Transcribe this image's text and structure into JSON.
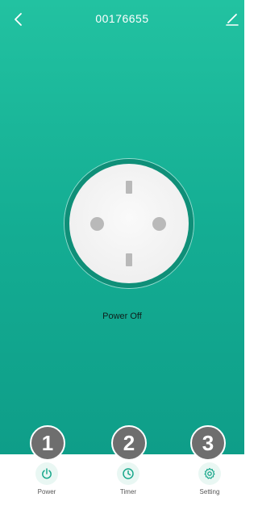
{
  "header": {
    "title": "00176655",
    "back_icon": "chevron-left-icon",
    "edit_icon": "pencil-icon"
  },
  "socket": {
    "status_text": "Power Off"
  },
  "bottom_nav": {
    "items": [
      {
        "label": "Power",
        "icon": "power-icon",
        "badge": "1"
      },
      {
        "label": "Timer",
        "icon": "clock-icon",
        "badge": "2"
      },
      {
        "label": "Setting",
        "icon": "gear-icon",
        "badge": "3"
      }
    ]
  },
  "colors": {
    "background_top": "#22c2a1",
    "background_bottom": "#0d9a86",
    "accent": "#1aa88c",
    "badge": "#6e6e6e"
  }
}
